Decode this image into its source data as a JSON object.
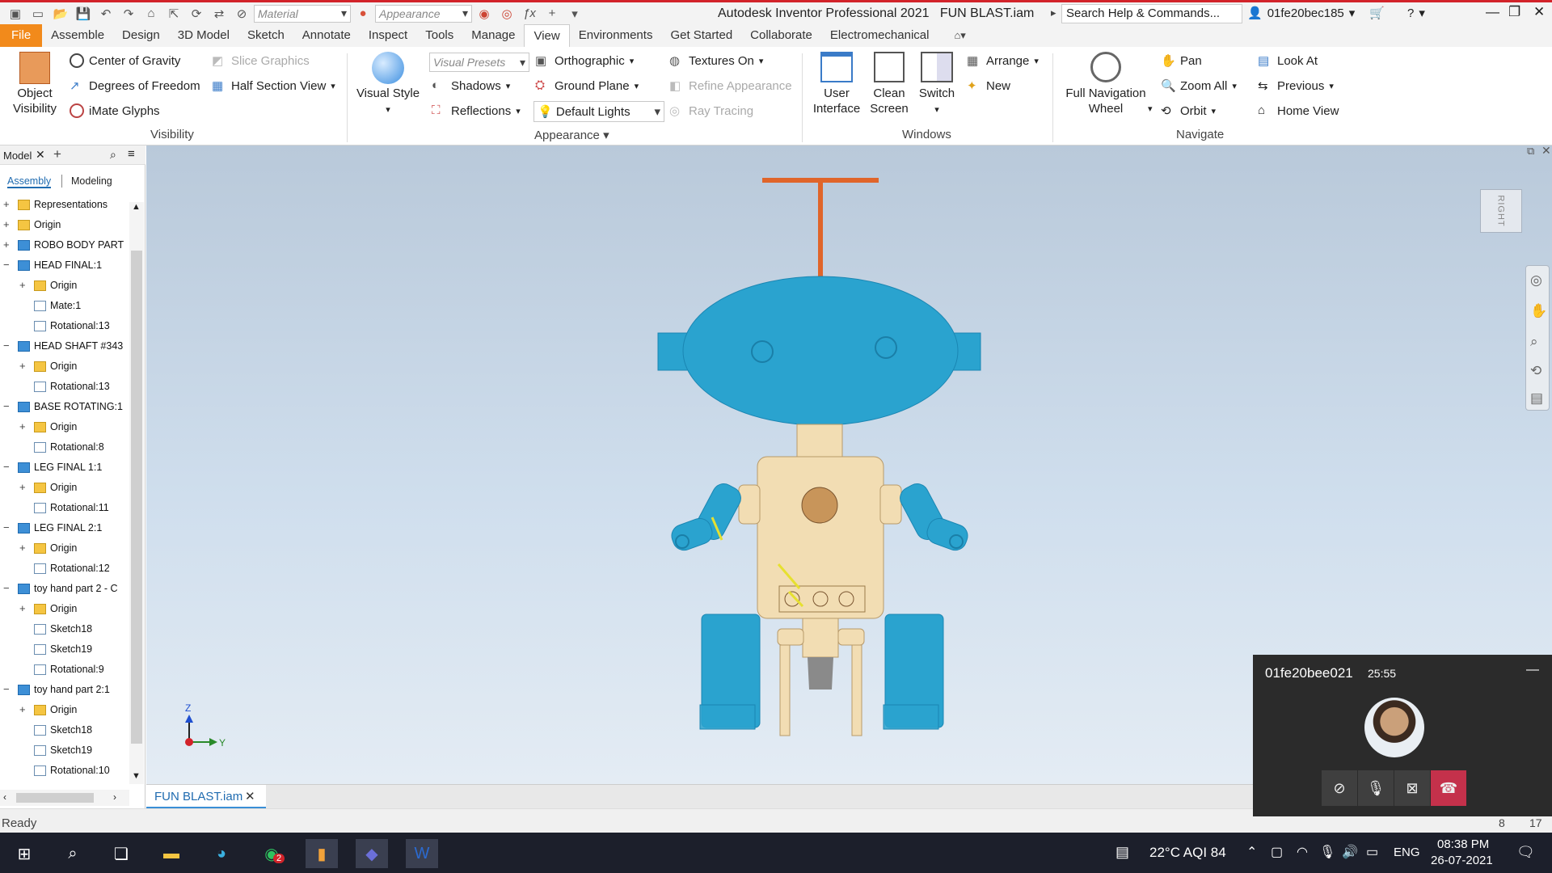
{
  "titlebar": {
    "material_combo": "Material",
    "appearance_combo": "Appearance",
    "app_title": "Autodesk Inventor Professional 2021",
    "file_title": "FUN BLAST.iam",
    "search_placeholder": "Search Help & Commands...",
    "username": "01fe20bec185",
    "accent_color": "#d2232a"
  },
  "menu": {
    "file": "File",
    "tabs": [
      "Assemble",
      "Design",
      "3D Model",
      "Sketch",
      "Annotate",
      "Inspect",
      "Tools",
      "Manage",
      "View",
      "Environments",
      "Get Started",
      "Collaborate",
      "Electromechanical"
    ],
    "active": "View"
  },
  "ribbon": {
    "visibility": {
      "object_visibility_1": "Object",
      "object_visibility_2": "Visibility",
      "center_of_gravity": "Center of Gravity",
      "degrees_of_freedom": "Degrees of Freedom",
      "imate_glyphs": "iMate Glyphs",
      "slice_graphics": "Slice Graphics",
      "half_section_view": "Half Section View",
      "panel": "Visibility"
    },
    "appearance": {
      "visual_style": "Visual Style",
      "visual_presets": "Visual Presets",
      "shadows": "Shadows",
      "reflections": "Reflections",
      "orthographic": "Orthographic",
      "ground_plane": "Ground Plane",
      "default_lights": "Default Lights",
      "textures_on": "Textures On",
      "refine_appearance": "Refine Appearance",
      "ray_tracing": "Ray Tracing",
      "panel": "Appearance"
    },
    "windows": {
      "user_interface_1": "User",
      "user_interface_2": "Interface",
      "clean_screen_1": "Clean",
      "clean_screen_2": "Screen",
      "switch": "Switch",
      "arrange": "Arrange",
      "new": "New",
      "panel": "Windows"
    },
    "navigate": {
      "full_nav_1": "Full Navigation",
      "full_nav_2": "Wheel",
      "pan": "Pan",
      "zoom_all": "Zoom All",
      "orbit": "Orbit",
      "look_at": "Look At",
      "previous": "Previous",
      "home_view": "Home View",
      "panel": "Navigate"
    }
  },
  "browser": {
    "title": "Model",
    "tab_assembly": "Assembly",
    "tab_modeling": "Modeling",
    "items": [
      {
        "label": "Representations",
        "depth": 0,
        "icon": "folder",
        "exp": "+"
      },
      {
        "label": "Origin",
        "depth": 0,
        "icon": "folder",
        "exp": "+"
      },
      {
        "label": "ROBO BODY PART",
        "depth": 0,
        "icon": "part",
        "exp": "+"
      },
      {
        "label": "HEAD FINAL:1",
        "depth": 0,
        "icon": "part",
        "exp": "−"
      },
      {
        "label": "Origin",
        "depth": 1,
        "icon": "folder",
        "exp": "+"
      },
      {
        "label": "Mate:1",
        "depth": 1,
        "icon": "feat",
        "exp": ""
      },
      {
        "label": "Rotational:13",
        "depth": 1,
        "icon": "feat",
        "exp": ""
      },
      {
        "label": "HEAD SHAFT #343",
        "depth": 0,
        "icon": "part",
        "exp": "−"
      },
      {
        "label": "Origin",
        "depth": 1,
        "icon": "folder",
        "exp": "+"
      },
      {
        "label": "Rotational:13",
        "depth": 1,
        "icon": "feat",
        "exp": ""
      },
      {
        "label": "BASE ROTATING:1",
        "depth": 0,
        "icon": "part",
        "exp": "−"
      },
      {
        "label": "Origin",
        "depth": 1,
        "icon": "folder",
        "exp": "+"
      },
      {
        "label": "Rotational:8",
        "depth": 1,
        "icon": "feat",
        "exp": ""
      },
      {
        "label": "LEG FINAL 1:1",
        "depth": 0,
        "icon": "part",
        "exp": "−"
      },
      {
        "label": "Origin",
        "depth": 1,
        "icon": "folder",
        "exp": "+"
      },
      {
        "label": "Rotational:11",
        "depth": 1,
        "icon": "feat",
        "exp": ""
      },
      {
        "label": "LEG FINAL 2:1",
        "depth": 0,
        "icon": "part",
        "exp": "−"
      },
      {
        "label": "Origin",
        "depth": 1,
        "icon": "folder",
        "exp": "+"
      },
      {
        "label": "Rotational:12",
        "depth": 1,
        "icon": "feat",
        "exp": ""
      },
      {
        "label": "toy hand part 2 - C",
        "depth": 0,
        "icon": "part",
        "exp": "−"
      },
      {
        "label": "Origin",
        "depth": 1,
        "icon": "folder",
        "exp": "+"
      },
      {
        "label": "Sketch18",
        "depth": 1,
        "icon": "feat",
        "exp": ""
      },
      {
        "label": "Sketch19",
        "depth": 1,
        "icon": "feat",
        "exp": ""
      },
      {
        "label": "Rotational:9",
        "depth": 1,
        "icon": "feat",
        "exp": ""
      },
      {
        "label": "toy hand part 2:1",
        "depth": 0,
        "icon": "part",
        "exp": "−"
      },
      {
        "label": "Origin",
        "depth": 1,
        "icon": "folder",
        "exp": "+"
      },
      {
        "label": "Sketch18",
        "depth": 1,
        "icon": "feat",
        "exp": ""
      },
      {
        "label": "Sketch19",
        "depth": 1,
        "icon": "feat",
        "exp": ""
      },
      {
        "label": "Rotational:10",
        "depth": 1,
        "icon": "feat",
        "exp": ""
      }
    ]
  },
  "viewport": {
    "viewcube_label": "RIGHT",
    "axis_z": "Z",
    "axis_y": "Y",
    "robot_color": "#2aa3cf",
    "body_color": "#f2ddb3",
    "antenna_color": "#e0652a"
  },
  "doc_tab": "FUN BLAST.iam",
  "status": {
    "text": "Ready",
    "num1": "8",
    "num2": "17"
  },
  "call": {
    "name": "01fe20bee021",
    "time": "25:55"
  },
  "taskbar": {
    "weather": "22°C  AQI 84",
    "lang": "ENG",
    "time": "08:38 PM",
    "date": "26-07-2021",
    "whatsapp_badge": "2"
  }
}
